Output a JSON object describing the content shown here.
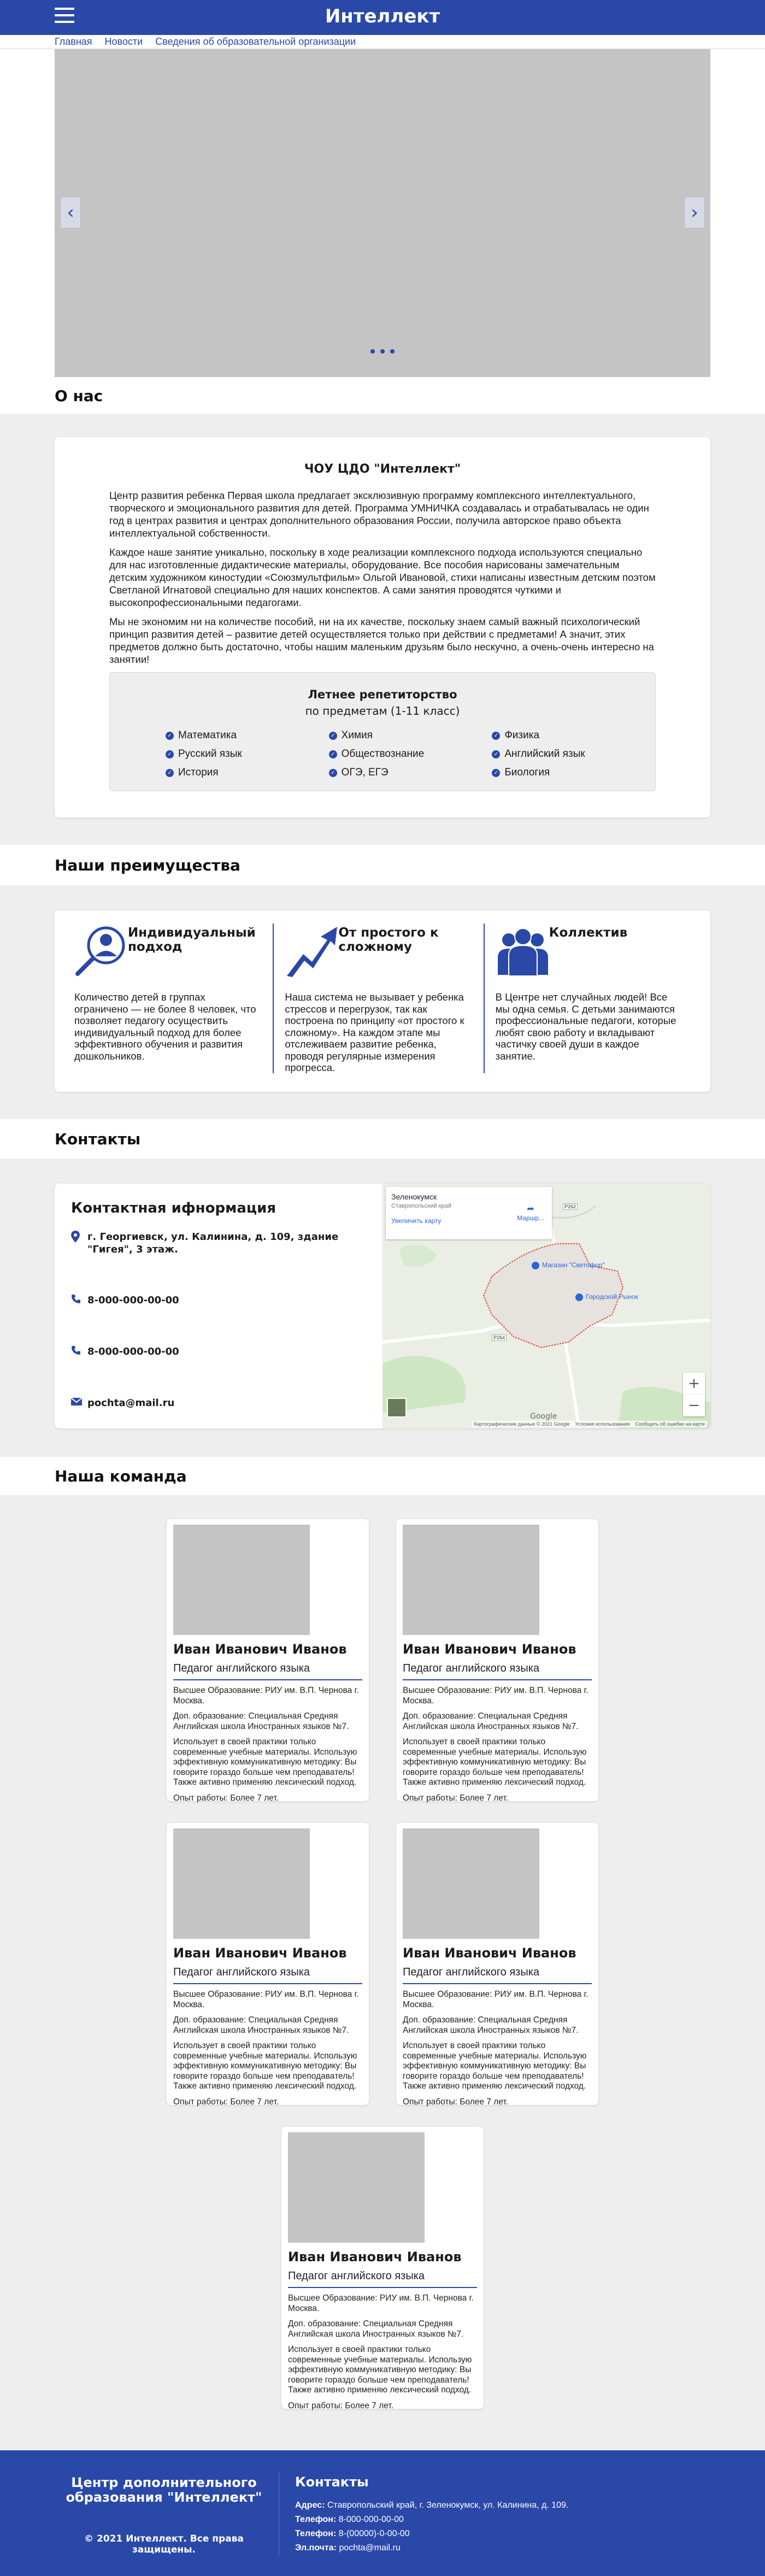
{
  "header": {
    "brand": "Интеллект"
  },
  "crumbs": [
    "Главная",
    "Новости",
    "Сведения об образовательной организации"
  ],
  "sections": {
    "about": "О нас",
    "advantages": "Наши преимущества",
    "contacts": "Контакты",
    "team": "Наша команда"
  },
  "about": {
    "title": "ЧОУ ЦДО \"Интеллект\"",
    "p1": "Центр развития ребенка Первая школа предлагает эксклюзивную программу комплексного интеллектуального, творческого и эмоционального развития для детей. Программа УМНИЧКА создавалась и отрабатывалась не один год в центрах развития и центрах дополнительного образования России, получила авторское право объекта интеллектуальной собственности.",
    "p2": "Каждое наше занятие уникально, поскольку в ходе реализации комплексного подхода используются специально для нас изготовленные дидактические материалы, оборудование. Все пособия нарисованы замечательным детским художником киностудии «Союзмультфильм» Ольгой Ивановой, стихи написаны известным детским поэтом Светланой Игнатовой специально для наших конспектов. А сами занятия проводятся чуткими и высокопрофессиональными педагогами.",
    "p3": "Мы не экономим ни на количестве пособий, ни на их качестве, поскольку знаем самый важный психологический принцип развития детей – развитие детей осуществляется только при действии с предметами!  А значит, этих предметов должно быть достаточно, чтобы нашим маленьким друзьям было нескучно, а очень-очень интересно на занятии!",
    "summer_title": "Летнее репетиторство",
    "summer_sub": "по предметам (1-11 класс)",
    "subjects": [
      "Математика",
      "Химия",
      "Физика",
      "Русский язык",
      "Обществознание",
      "Английский язык",
      "История",
      "ОГЭ, ЕГЭ",
      "Биология"
    ]
  },
  "advantages": [
    {
      "title": "Индивидуальный подход",
      "icon": "user-search-icon",
      "text": "Количество детей в группах ограничено — не более 8 человек, что позволяет педагогу осуществить индивидуальный подход для более эффективного обучения и развития дошкольников."
    },
    {
      "title": "От простого к сложному",
      "icon": "growth-arrow-icon",
      "text": "Наша система не вызывает у ребенка стрессов и перегрузок, так как построена по принципу «от простого к сложному». На каждом этапе мы отслеживаем развитие ребенка, проводя регулярные измерения прогресса."
    },
    {
      "title": "Коллектив",
      "icon": "team-icon",
      "text": "В Центре нет случайных людей! Все мы одна семья. С детьми занимаются профессиональные педагоги, которые любят свою работу и вкладывают частичку своей души в каждое занятие."
    }
  ],
  "contact": {
    "title": "Контактная ифнормация",
    "address": "г. Георгиевск, ул. Калинина, д. 109, здание \"Гигея\", 3 этаж.",
    "phone1": "8-000-000-00-00",
    "phone2": "8-000-000-00-00",
    "email": "pochta@mail.ru"
  },
  "map": {
    "city": "Зеленокумск",
    "region": "Ставропольский край",
    "bigger": "Увеличить карту",
    "route": "Маршр...",
    "place1": "Магазин \"Светофор\"",
    "place2": "Городской Рынок",
    "road1": "P262",
    "road2": "P264",
    "attribution": "Картографические данные © 2021 Google",
    "terms": "Условия использования",
    "report": "Сообщить об ошибке на карте",
    "google": "Google"
  },
  "team": [
    {
      "name": "Иван Иванович Иванов",
      "role": "Педагог английского языка",
      "edu": "Высшее Образование: РИУ им. В.П. Чернова г. Москва.",
      "extra": "Доп. образование: Специальная Средняя Английская школа Иностранных языков №7.",
      "about": "Использует в своей практики только современные учебные материалы. Использую эффективную коммуникативную методику: Вы говорите гораздо больше чем преподаватель! Также активно применяю лексический подход.",
      "exp": "Опыт работы: Более 7 лет."
    },
    {
      "name": "Иван Иванович Иванов",
      "role": "Педагог английского языка",
      "edu": "Высшее Образование: РИУ им. В.П. Чернова г. Москва.",
      "extra": "Доп. образование: Специальная Средняя Английская школа Иностранных языков №7.",
      "about": "Использует в своей практики только современные учебные материалы. Использую эффективную коммуникативную методику: Вы говорите гораздо больше чем преподаватель! Также активно применяю лексический подход.",
      "exp": "Опыт работы: Более 7 лет."
    },
    {
      "name": "Иван Иванович Иванов",
      "role": "Педагог английского языка",
      "edu": "Высшее Образование: РИУ им. В.П. Чернова г. Москва.",
      "extra": "Доп. образование: Специальная Средняя Английская школа Иностранных языков №7.",
      "about": "Использует в своей практики только современные учебные материалы. Использую эффективную коммуникативную методику: Вы говорите гораздо больше чем преподаватель! Также активно применяю лексический подход.",
      "exp": "Опыт работы: Более 7 лет."
    },
    {
      "name": "Иван Иванович Иванов",
      "role": "Педагог английского языка",
      "edu": "Высшее Образование: РИУ им. В.П. Чернова г. Москва.",
      "extra": "Доп. образование: Специальная Средняя Английская школа Иностранных языков №7.",
      "about": "Использует в своей практики только современные учебные материалы. Использую эффективную коммуникативную методику: Вы говорите гораздо больше чем преподаватель! Также активно применяю лексический подход.",
      "exp": "Опыт работы: Более 7 лет."
    },
    {
      "name": "Иван Иванович Иванов",
      "role": "Педагог английского языка",
      "edu": "Высшее Образование: РИУ им. В.П. Чернова г. Москва.",
      "extra": "Доп. образование: Специальная Средняя Английская школа Иностранных языков №7.",
      "about": "Использует в своей практики только современные учебные материалы. Использую эффективную коммуникативную методику: Вы говорите гораздо больше чем преподаватель! Также активно применяю лексический подход.",
      "exp": "Опыт работы: Более 7 лет."
    }
  ],
  "footer": {
    "org": "Центр дополнительного образования \"Интеллект\"",
    "copyright": "© 2021 Интеллект. Все права защищены.",
    "contacts_title": "Контакты",
    "address_label": "Адрес:",
    "address": "Ставропольский край, г. Зеленокумск, ул. Калинина, д. 109.",
    "phone_label": "Телефон:",
    "phone1": "8-000-000-00-00",
    "phone2": "8-(00000)-0-00-00",
    "email_label": "Эл.почта:",
    "email": "pochta@mail.ru"
  },
  "colors": {
    "primary": "#2a48a8",
    "band": "#eeeeee",
    "placeholder": "#c4c4c4"
  }
}
